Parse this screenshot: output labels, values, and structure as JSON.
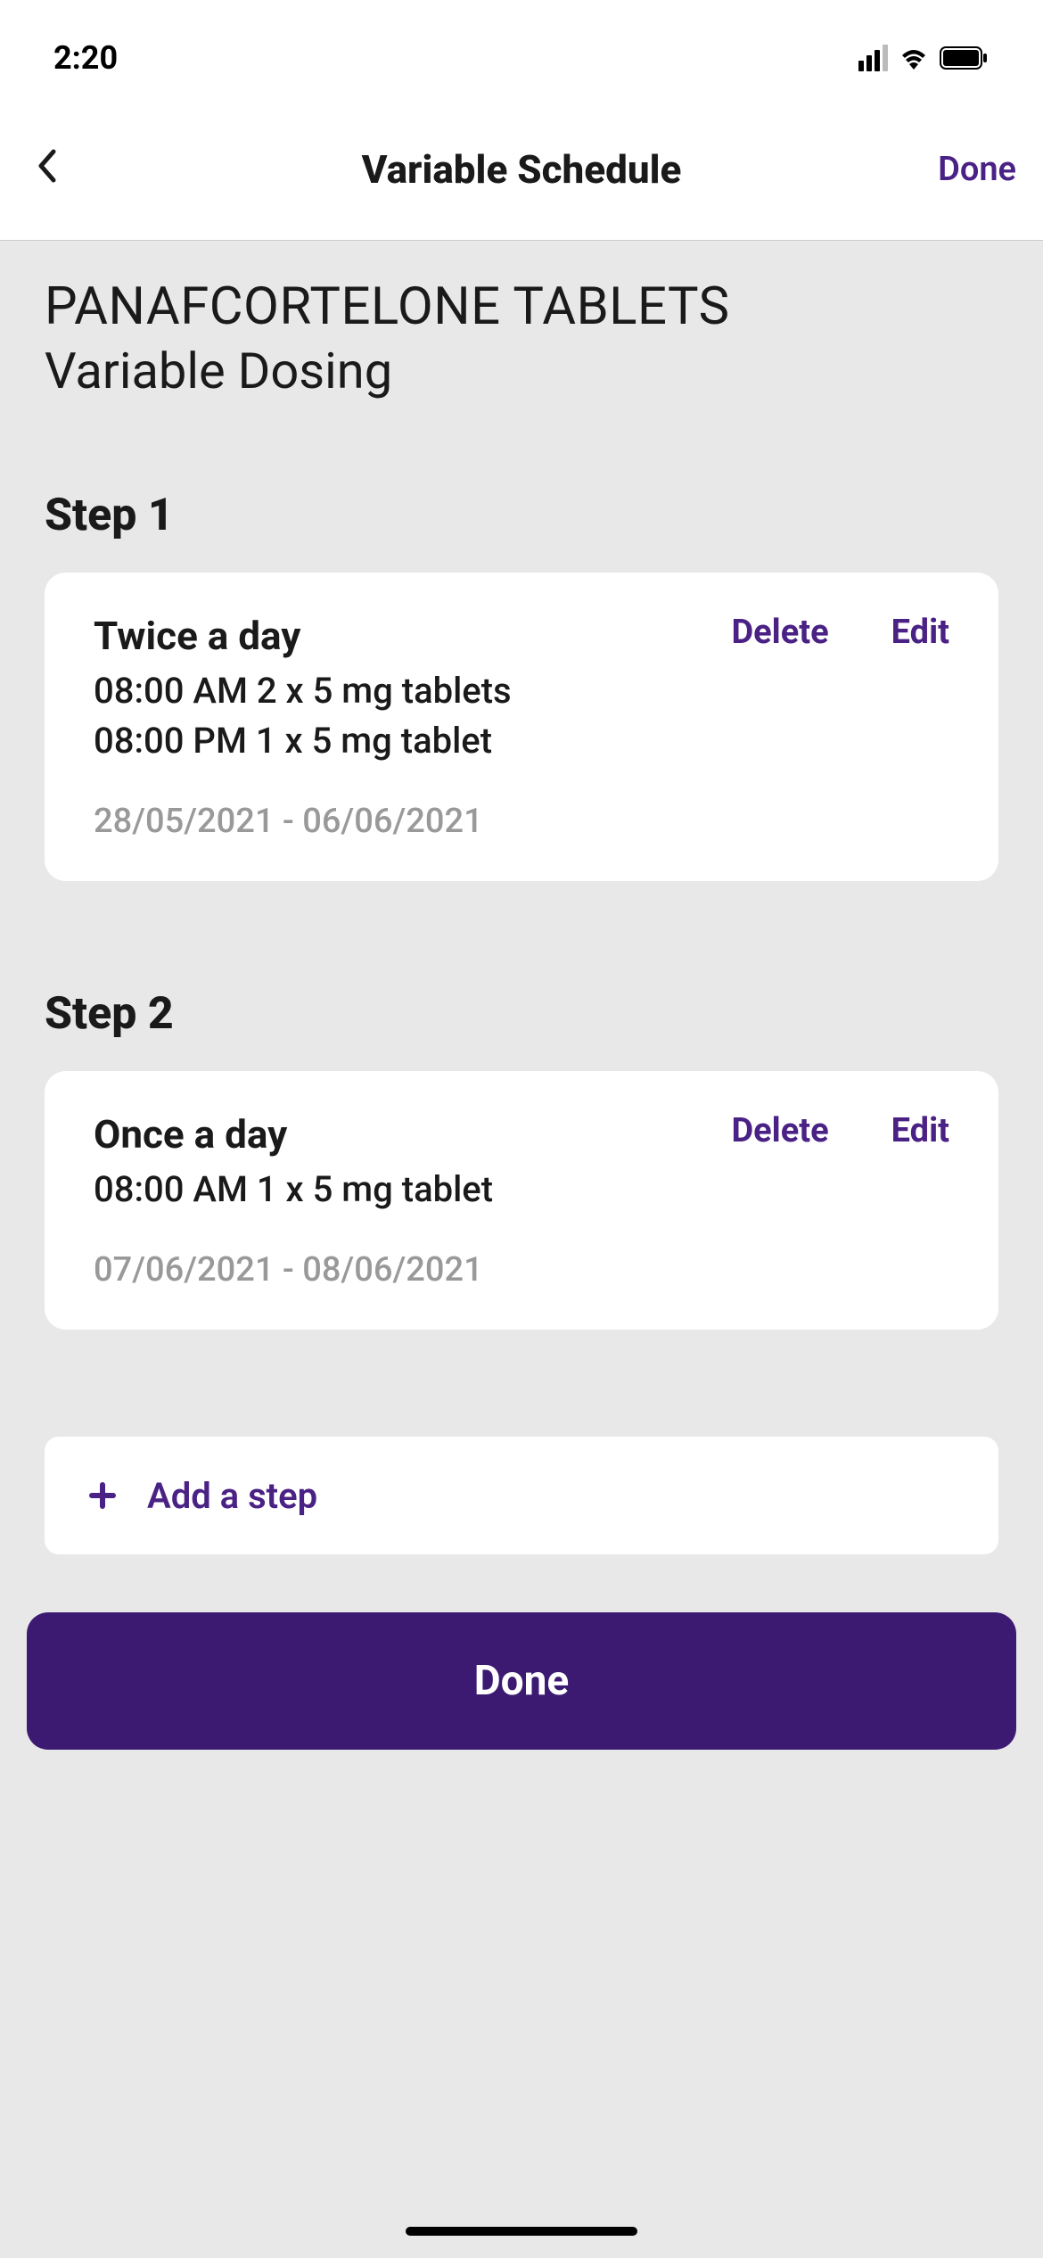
{
  "status": {
    "time": "2:20"
  },
  "nav": {
    "title": "Variable Schedule",
    "done": "Done"
  },
  "medication": {
    "name": "PANAFCORTELONE TABLETS",
    "subtitle": "Variable Dosing"
  },
  "steps": [
    {
      "label": "Step 1",
      "frequency": "Twice a day",
      "doses": [
        "08:00 AM 2 x 5 mg tablets",
        "08:00 PM 1 x 5 mg tablet"
      ],
      "date_range": "28/05/2021 - 06/06/2021",
      "delete": "Delete",
      "edit": "Edit"
    },
    {
      "label": "Step 2",
      "frequency": "Once a day",
      "doses": [
        "08:00 AM 1 x 5 mg tablet"
      ],
      "date_range": "07/06/2021 - 08/06/2021",
      "delete": "Delete",
      "edit": "Edit"
    }
  ],
  "add_step": {
    "label": "Add a step"
  },
  "done_button": {
    "label": "Done"
  }
}
